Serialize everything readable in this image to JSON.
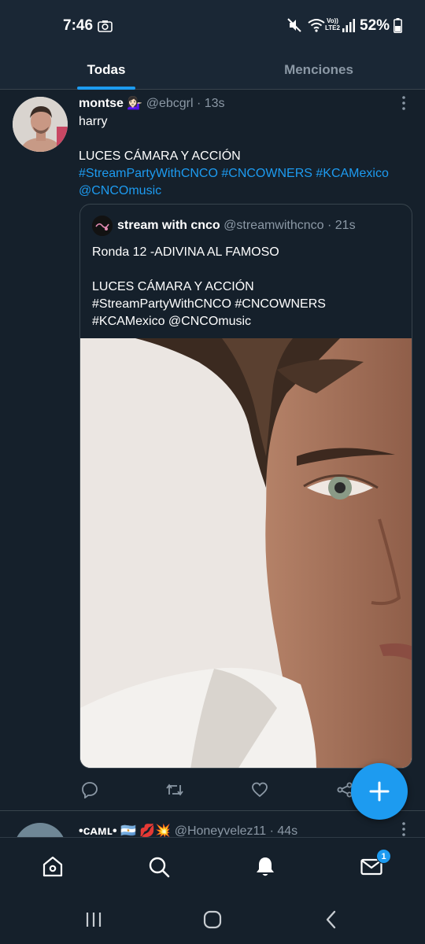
{
  "status_bar": {
    "time": "7:46",
    "volte_top": "Vo))",
    "volte_bottom": "LTE2",
    "battery": "52%"
  },
  "tabs": {
    "all": "Todas",
    "mentions": "Menciones"
  },
  "tweet": {
    "name": "montse 💁🏻‍♀️",
    "handle": "@ebcgrl · 13s",
    "text_line1": "harry",
    "text_line3": "LUCES CÁMARA Y ACCIÓN",
    "hashtags_line": "#StreamPartyWithCNCO  #CNCOWNERS #KCAMexico",
    "mention_line": "@CNCOmusic",
    "quote": {
      "name": "stream with cnco",
      "handle": "@streamwithcnco · 21s",
      "line1": "Ronda 12 -ADIVINA AL FAMOSO",
      "line3": "LUCES CÁMARA Y ACCIÓN",
      "line4": "#StreamPartyWithCNCO  #CNCOWNERS",
      "line5": "#KCAMexico @CNCOmusic"
    }
  },
  "next_tweet": {
    "name": "•ᴄᴀᴍʟ• 🇦🇷 💋💥",
    "handle": "@Honeyvelez11 · 44s"
  },
  "bottom_nav": {
    "messages_badge": "1"
  },
  "colors": {
    "background": "#15202b",
    "accent": "#1d9bf0",
    "secondary_text": "#8b98a5",
    "divider": "#38444d"
  }
}
